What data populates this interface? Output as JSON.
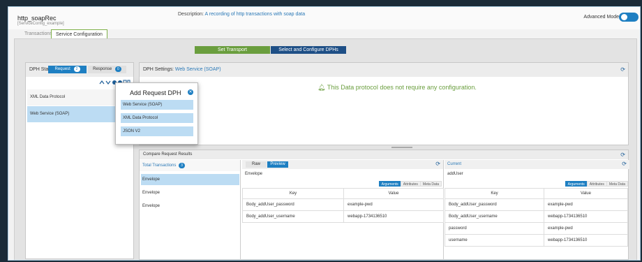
{
  "app": {
    "title": "http_soapRec",
    "subtitle": "[ServiceConfig_example]"
  },
  "description": {
    "label": "Description:",
    "text": "A recording of http transactions with soap data"
  },
  "advanced_mode": {
    "label": "Advanced Mode",
    "enabled": true
  },
  "tabs": [
    {
      "label": "Transactions",
      "active": false
    },
    {
      "label": "Service Configuration",
      "active": true
    }
  ],
  "actions": {
    "set_transport": "Set Transport",
    "configure_dphs": "Select and Configure DPHs"
  },
  "dph_stack": {
    "title": "DPH Stack",
    "request_label": "Request",
    "request_count": "2",
    "response_label": "Response",
    "response_count": "0",
    "tools": "⌃ ⌄ ⊕ ⊗ ⧉ ⧉",
    "items": [
      "XML Data Protocol",
      "Web Service (SOAP)"
    ]
  },
  "dph_settings": {
    "title": "DPH Settings:",
    "name": "Web Service (SOAP)",
    "message": "This Data protocol does not require any configuration."
  },
  "compare": {
    "title": "Compare Request Results",
    "total_label": "Total Transactions",
    "total_count": "3",
    "transactions": [
      "Envelope",
      "Envelope",
      "Envelope"
    ],
    "raw_label": "Raw",
    "preview_label": "Preview",
    "preview_name": "Envelope",
    "subtabs": [
      "Arguments",
      "Attributes",
      "Meta Data"
    ],
    "key_header": "Key",
    "value_header": "Value",
    "preview_rows": [
      {
        "key": "Body_addUser_password",
        "value": "example-pwd"
      },
      {
        "key": "Body_addUser_username",
        "value": "webapp-1734136510"
      }
    ],
    "current_label": "Current",
    "current_name": "addUser",
    "current_rows": [
      {
        "key": "Body_addUser_password",
        "value": "example-pwd"
      },
      {
        "key": "Body_addUser_username",
        "value": "webapp-1734136510"
      },
      {
        "key": "password",
        "value": "example-pwd"
      },
      {
        "key": "username",
        "value": "webapp-1734136510"
      }
    ]
  },
  "popup": {
    "title": "Add Request DPH",
    "options": [
      "Web Service (SOAP)",
      "XML Data Protocol",
      "JSON V2"
    ]
  },
  "colors": {
    "accent": "#1e7fc2",
    "success": "#6a9e3e",
    "navy": "#1e4f86",
    "selection": "#bcdcf3"
  },
  "icons": {
    "refresh": "refresh-icon",
    "close": "close-icon",
    "check": "bell-icon"
  }
}
